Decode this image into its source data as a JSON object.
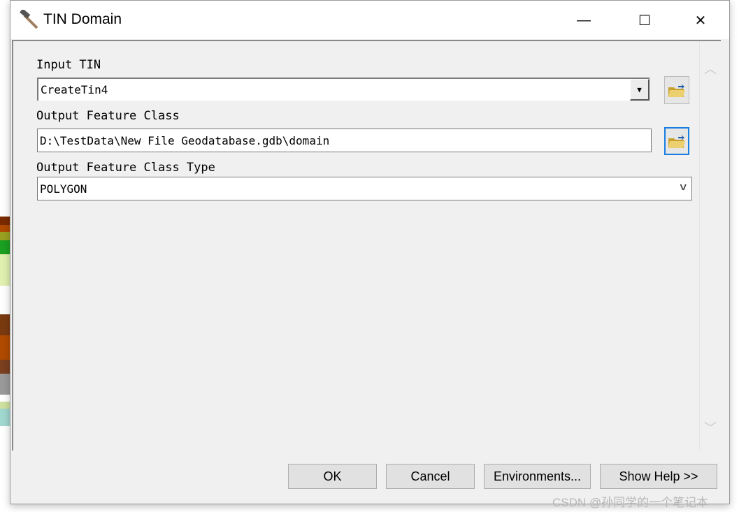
{
  "window": {
    "title": "TIN Domain",
    "controls": {
      "minimize": "—",
      "maximize": "☐",
      "close": "✕"
    }
  },
  "form": {
    "input_tin": {
      "label": "Input TIN",
      "value": "CreateTin4"
    },
    "output_feature_class": {
      "label": "Output Feature Class",
      "value": "D:\\TestData\\New File Geodatabase.gdb\\domain"
    },
    "output_type": {
      "label": "Output Feature Class Type",
      "value": "POLYGON"
    }
  },
  "buttons": {
    "ok": "OK",
    "cancel": "Cancel",
    "environments": "Environments...",
    "show_help": "Show Help >>"
  },
  "watermark": "CSDN @孙同学的一个笔记本",
  "colors": {
    "focus": "#1a7ee0",
    "folder": "#e8c24a"
  }
}
